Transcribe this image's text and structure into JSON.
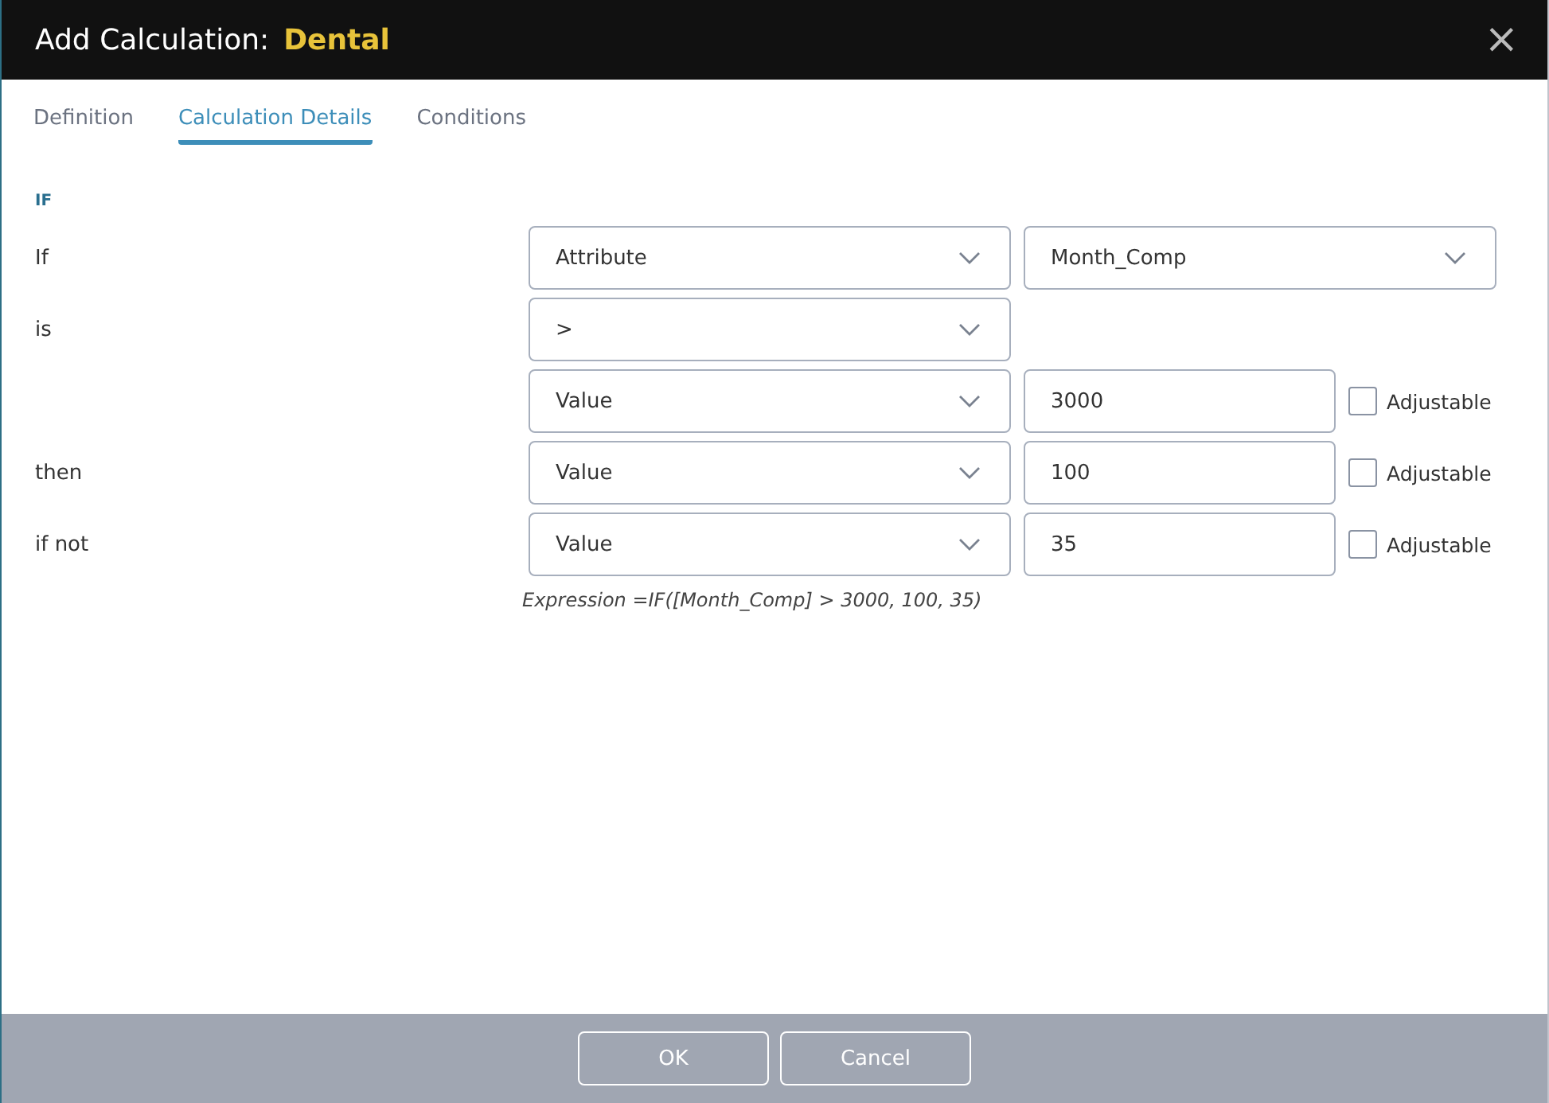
{
  "window": {
    "title": "Add Calculation:",
    "subject": "Dental",
    "close": "×"
  },
  "tabs": [
    {
      "label": "Definition",
      "selected": false
    },
    {
      "label": "Calculation Details",
      "selected": true
    },
    {
      "label": "Conditions",
      "selected": false
    }
  ],
  "section": "IF",
  "rows": [
    {
      "label": "If",
      "first": {
        "value": "Attribute"
      },
      "second": {
        "kind": "select",
        "value": "Month_Comp"
      }
    },
    {
      "label": "is",
      "first": {
        "value": ">"
      }
    },
    {
      "first": {
        "value": "Value"
      },
      "second": {
        "kind": "input",
        "value": "3000"
      },
      "adjustable": {
        "label": "Adjustable",
        "checked": false
      }
    },
    {
      "label": "then",
      "first": {
        "value": "Value"
      },
      "second": {
        "kind": "input",
        "value": "100"
      },
      "adjustable": {
        "label": "Adjustable",
        "checked": false
      }
    },
    {
      "label": "if not",
      "first": {
        "value": "Value"
      },
      "second": {
        "kind": "input",
        "value": "35"
      },
      "adjustable": {
        "label": "Adjustable",
        "checked": false
      }
    }
  ],
  "expression": "Expression =IF([Month_Comp] > 3000, 100, 35)",
  "buttons": [
    "OK",
    "Cancel"
  ]
}
